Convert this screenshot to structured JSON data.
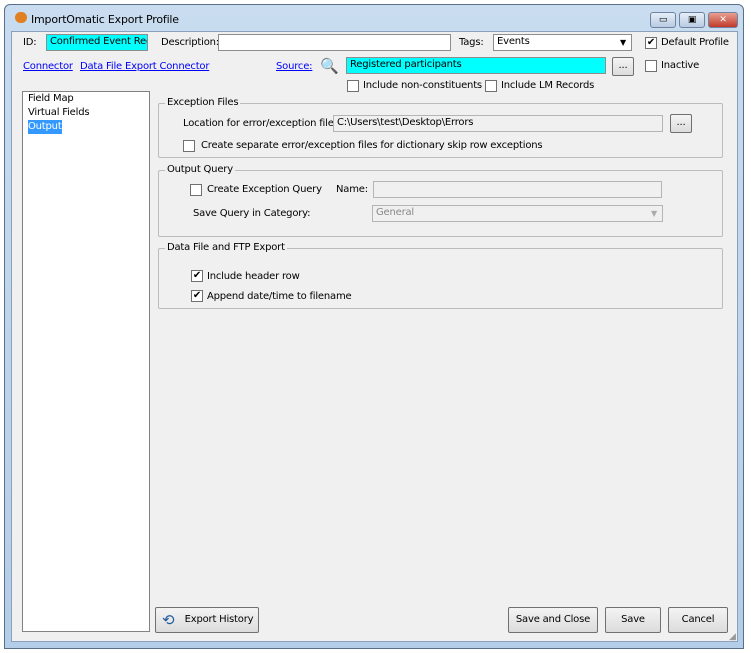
{
  "window": {
    "title": "ImportOmatic Export Profile",
    "buttons": {
      "minimize": "▭",
      "maximize": "▣",
      "close": "✕"
    }
  },
  "header": {
    "id_label": "ID:",
    "id_value": "Confirmed Event Reg",
    "description_label": "Description:",
    "description_value": "",
    "tags_label": "Tags:",
    "tags_value": "Events",
    "default_profile_label": "Default Profile",
    "default_profile_checked": true,
    "inactive_label": "Inactive",
    "inactive_checked": false,
    "connector_link": "Connector",
    "connector_value_link": "Data File Export Connector",
    "source_link": "Source:",
    "source_value": "Registered participants",
    "browse_label": "...",
    "include_nonconstituents_label": "Include non-constituents",
    "include_lm_label": "Include LM Records"
  },
  "sidebar": {
    "items": [
      {
        "label": "Field Map"
      },
      {
        "label": "Virtual Fields"
      },
      {
        "label": "Output",
        "selected": true
      }
    ]
  },
  "exception_files": {
    "title": "Exception Files",
    "location_label": "Location for error/exception files:",
    "location_value": "C:\\Users\\test\\Desktop\\Errors",
    "browse_label": "...",
    "separate_label": "Create separate error/exception files for dictionary skip row exceptions",
    "separate_checked": false
  },
  "output_query": {
    "title": "Output Query",
    "create_label": "Create Exception Query",
    "create_checked": false,
    "name_label": "Name:",
    "name_value": "",
    "category_label": "Save Query in Category:",
    "category_value": "General"
  },
  "data_file": {
    "title": "Data File  and FTP Export",
    "header_row_label": "Include header row",
    "header_row_checked": true,
    "append_label": "Append date/time to filename",
    "append_checked": true
  },
  "footer": {
    "export_history": "Export History",
    "save_close": "Save and Close",
    "save": "Save",
    "cancel": "Cancel"
  }
}
